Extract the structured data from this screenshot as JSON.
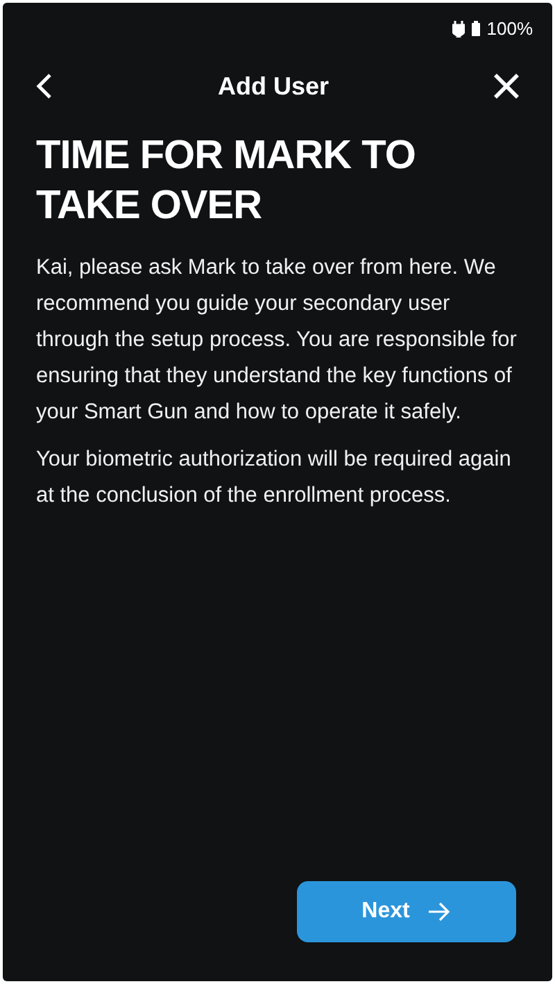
{
  "status_bar": {
    "battery": "100%"
  },
  "header": {
    "title": "Add User"
  },
  "heading": "TIME FOR MARK TO TAKE OVER",
  "paragraphs": [
    "Kai, please ask Mark to take over from here. We recommend you guide your secondary user through the setup process. You are responsible for ensuring that they understand the key functions of your Smart Gun and how to operate it safely.",
    "Your biometric authorization will be required again at the conclusion of the enrollment process."
  ],
  "buttons": [
    {
      "label": "Next"
    }
  ]
}
